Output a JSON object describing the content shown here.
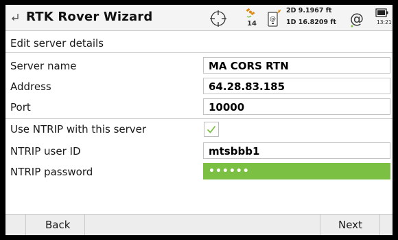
{
  "header": {
    "title": "RTK Rover Wizard",
    "satellites": "14",
    "precision_2d": "2D 9.1967 ft",
    "precision_1d": "1D 16.8209 ft",
    "time": "13:21"
  },
  "section_title": "Edit server details",
  "fields": {
    "server_name": {
      "label": "Server name",
      "value": "MA CORS RTN"
    },
    "address": {
      "label": "Address",
      "value": "64.28.83.185"
    },
    "port": {
      "label": "Port",
      "value": "10000"
    },
    "use_ntrip": {
      "label": "Use NTRIP with this server",
      "checked": true
    },
    "ntrip_user": {
      "label": "NTRIP user ID",
      "value": "mtsbbb1"
    },
    "ntrip_password": {
      "label": "NTRIP password",
      "value": "••••••"
    }
  },
  "footer": {
    "back_label": "Back",
    "next_label": "Next"
  },
  "colors": {
    "accent_green": "#7cc043",
    "satellite_orange": "#e08a10"
  }
}
